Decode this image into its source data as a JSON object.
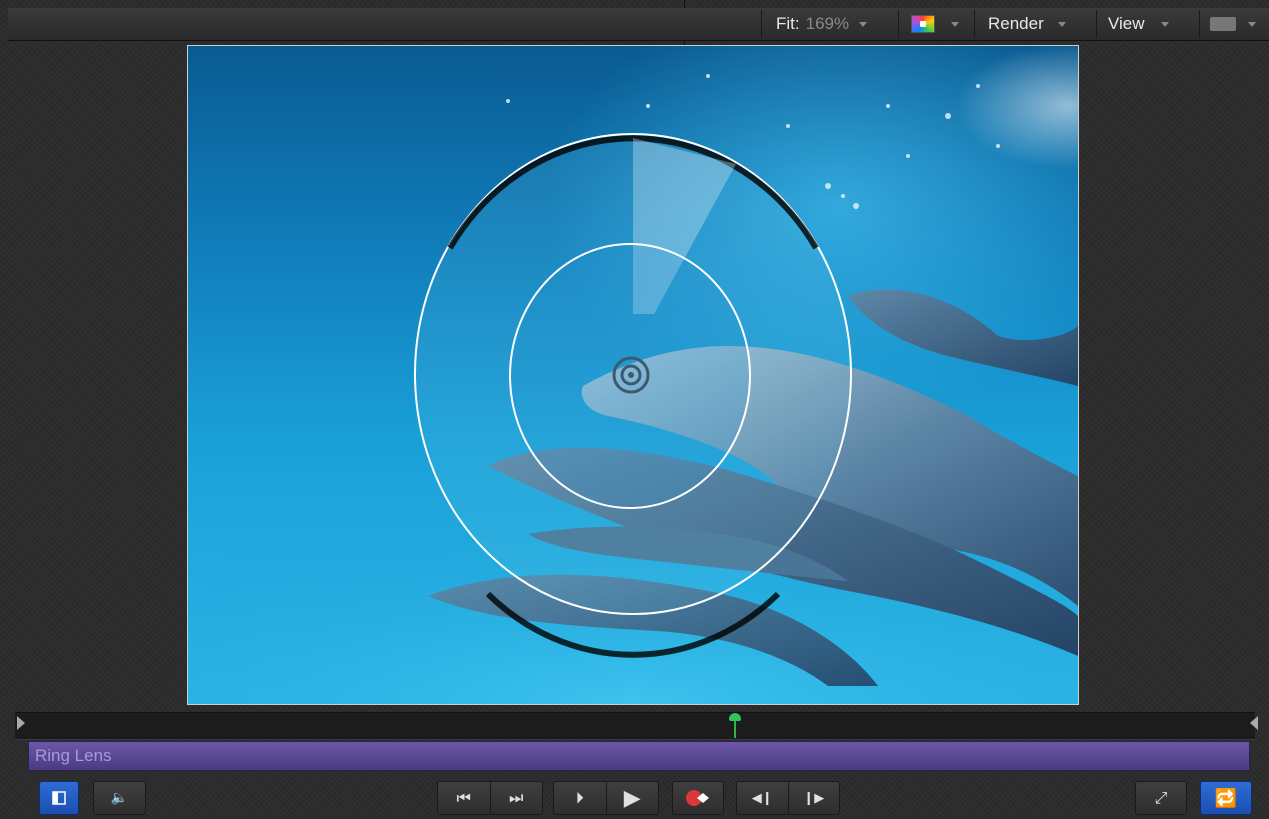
{
  "toolbar": {
    "fit_label": "Fit:",
    "fit_value": "169%",
    "render_label": "Render",
    "view_label": "View"
  },
  "canvas": {
    "content": "underwater dolphins with ring lens distortion"
  },
  "timeline": {
    "clip_label": "Ring Lens",
    "playhead_color": "#2fb34a",
    "clip_color": "#5c4a98"
  },
  "transport": {
    "go_to_start_icon": "go-to-start-icon",
    "go_to_end_icon": "go-to-end-icon",
    "play_from_start_icon": "play-from-start-icon",
    "play_icon": "play-icon",
    "record_icon": "record-icon",
    "prev_frame_icon": "previous-frame-icon",
    "next_frame_icon": "next-frame-icon",
    "loop_icon": "loop-icon",
    "fullscreen_icon": "fullscreen-icon"
  },
  "colors": {
    "accent_blue": "#1f5fc8"
  }
}
